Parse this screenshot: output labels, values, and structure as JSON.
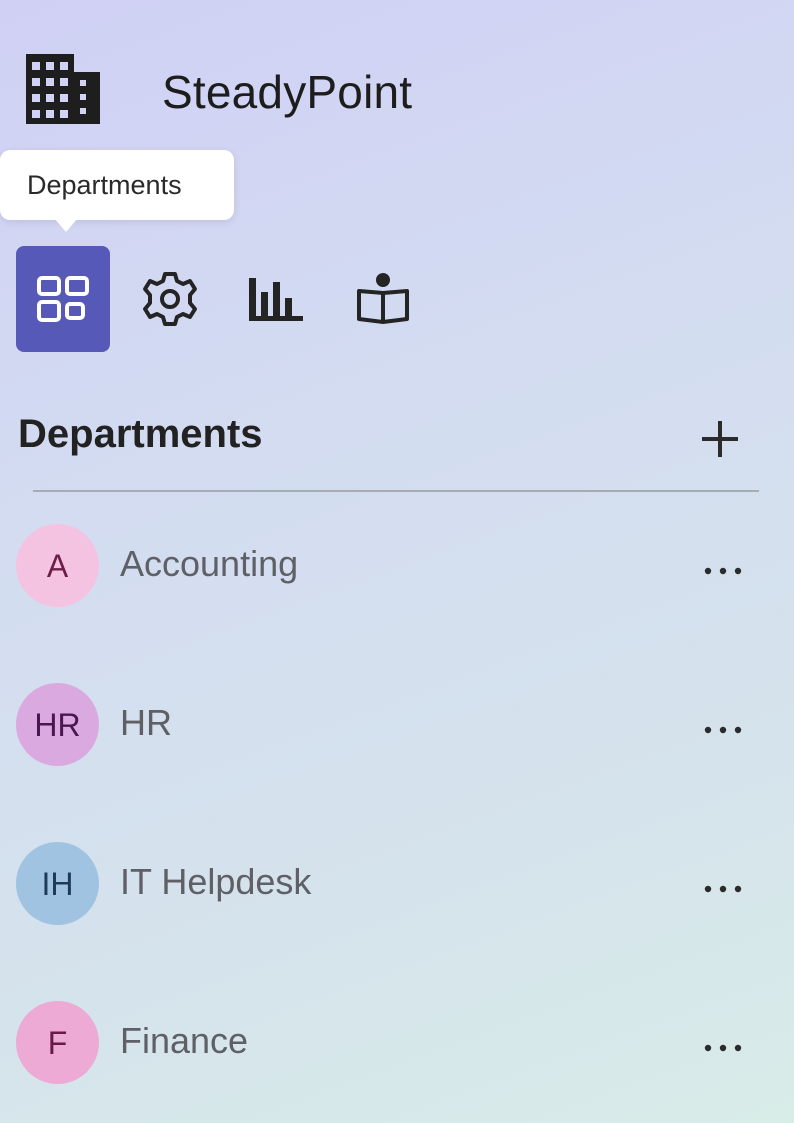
{
  "app": {
    "title": "SteadyPoint",
    "logo_icon": "building-icon"
  },
  "tooltip": {
    "text": "Departments"
  },
  "nav": {
    "items": [
      {
        "id": "departments",
        "icon": "apps-grid-icon",
        "active": true
      },
      {
        "id": "settings",
        "icon": "gear-icon",
        "active": false
      },
      {
        "id": "analytics",
        "icon": "bar-chart-icon",
        "active": false
      },
      {
        "id": "learning",
        "icon": "reader-book-icon",
        "active": false
      }
    ]
  },
  "section": {
    "title": "Departments",
    "add_icon": "plus-icon"
  },
  "departments": [
    {
      "initials": "A",
      "name": "Accounting",
      "avatar_bg": "#f5c3e2",
      "avatar_fg": "#6d1d4a",
      "more_icon": "more-horizontal-icon"
    },
    {
      "initials": "HR",
      "name": "HR",
      "avatar_bg": "#d9a9df",
      "avatar_fg": "#4a1550",
      "more_icon": "more-horizontal-icon"
    },
    {
      "initials": "IH",
      "name": "IT Helpdesk",
      "avatar_bg": "#9fc3e0",
      "avatar_fg": "#1d3a5a",
      "more_icon": "more-horizontal-icon"
    },
    {
      "initials": "F",
      "name": "Finance",
      "avatar_bg": "#ecaad5",
      "avatar_fg": "#6a1848",
      "more_icon": "more-horizontal-icon"
    }
  ],
  "colors": {
    "accent": "#5759b8",
    "divider": "#a9abb2"
  }
}
